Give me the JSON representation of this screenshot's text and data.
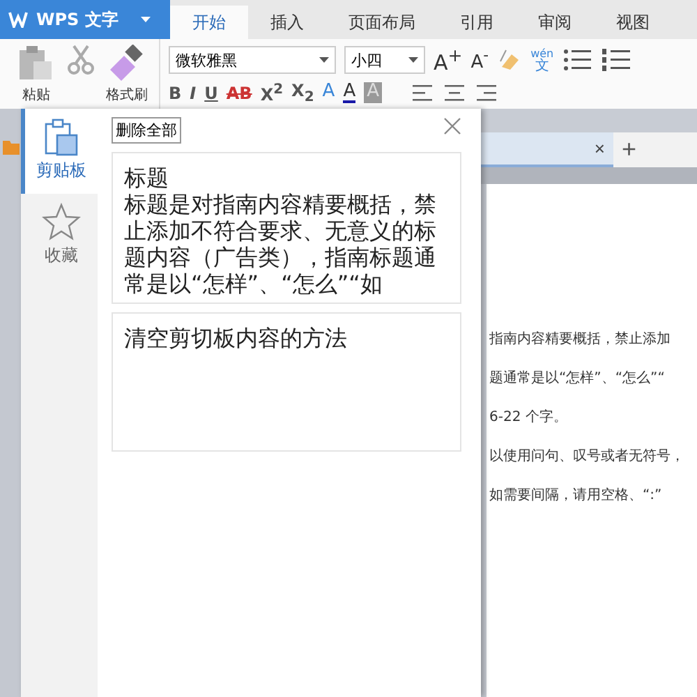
{
  "app_button": {
    "label": "WPS 文字"
  },
  "tabs": [
    {
      "label": "开始",
      "selected": true
    },
    {
      "label": "插入",
      "selected": false
    },
    {
      "label": "页面布局",
      "selected": false
    },
    {
      "label": "引用",
      "selected": false
    },
    {
      "label": "审阅",
      "selected": false
    },
    {
      "label": "视图",
      "selected": false
    }
  ],
  "ribbon": {
    "paste_label": "粘贴",
    "format_painter_label": "格式刷",
    "font_name": "微软雅黑",
    "font_size": "小四",
    "grow_font": "A$^{+}$",
    "shrink_font": "A$^{-}$",
    "phonetic_top": "wén",
    "phonetic_bottom": "文",
    "format_buttons": [
      {
        "label": "B",
        "kind": "bold"
      },
      {
        "label": "I",
        "kind": "italic"
      },
      {
        "label": "U",
        "kind": "underline"
      },
      {
        "label": "AB",
        "kind": "strike"
      },
      {
        "label": "X$^{2}$",
        "kind": "plain"
      },
      {
        "label": "X$_{2}$",
        "kind": "plain"
      }
    ],
    "color_buttons": [
      {
        "label": "A",
        "kind": "outline"
      },
      {
        "label": "A",
        "kind": "font_color",
        "color": "#1a1aa8"
      },
      {
        "label": "A",
        "kind": "shade"
      }
    ]
  },
  "clipboard_panel": {
    "nav": [
      {
        "label": "剪贴板",
        "kind": "clipboard",
        "selected": true
      },
      {
        "label": "收藏",
        "kind": "star",
        "selected": false
      }
    ],
    "delete_all": "删除全部",
    "items": [
      {
        "title": "标题",
        "text": "标题是对指南内容精要概括，禁止添加不符合要求、无意义的标题内容（广告类），指南标题通常是以“怎样”、“怎么”“如"
      },
      {
        "text": "清空剪切板内容的方法"
      }
    ]
  },
  "doc_tab": {
    "close": "×",
    "add": "+"
  },
  "document_lines": [
    "指南内容精要概括，禁止添加",
    "题通常是以“怎样”、“怎么”“",
    "6-22 个字。",
    "以使用问句、叹号或者无符号，",
    "如需要间隔，请用空格、“:”"
  ]
}
